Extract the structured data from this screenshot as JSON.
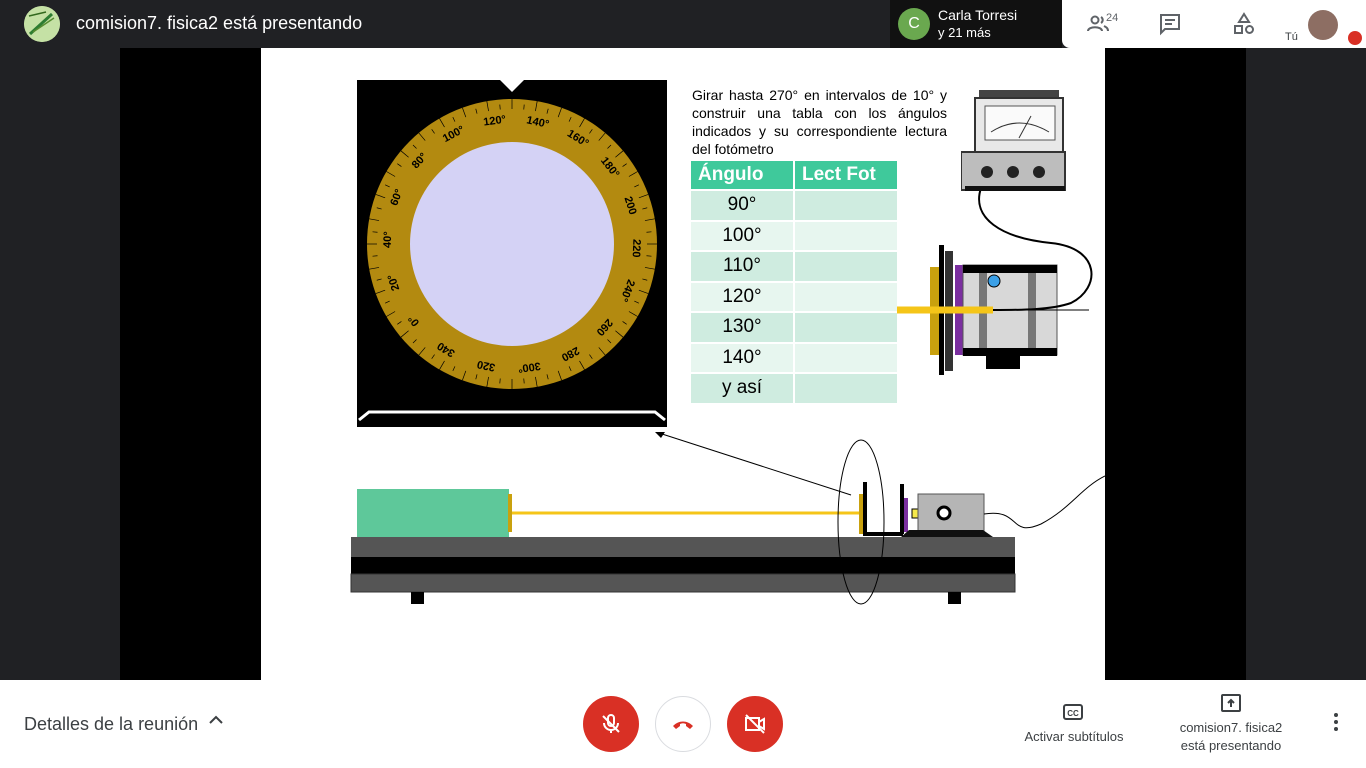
{
  "header": {
    "presenting_title": "comision7. fisica2 está presentando",
    "participant_initial": "C",
    "participant_name": "Carla Torresi",
    "participant_more": "y 21 más",
    "people_count": "24",
    "self_label": "Tú"
  },
  "slide": {
    "instructions": "Girar hasta 270° en intervalos de 10° y construir una tabla con los ángulos indicados y su correspondiente lectura del fotómetro",
    "table": {
      "headers": [
        "Ángulo",
        "Lect Fot"
      ],
      "rows": [
        [
          "90°",
          ""
        ],
        [
          "100°",
          ""
        ],
        [
          "110°",
          ""
        ],
        [
          "120°",
          ""
        ],
        [
          "130°",
          ""
        ],
        [
          "140°",
          ""
        ],
        [
          "y así",
          ""
        ]
      ]
    },
    "dial_labels": [
      "0°",
      "20°",
      "40°",
      "60°",
      "80°",
      "100°",
      "120°",
      "140°",
      "160°",
      "180°",
      "200",
      "220",
      "240°",
      "260",
      "280",
      "300°",
      "320",
      "340"
    ],
    "colors": {
      "dial_ring": "#b38a10",
      "dial_center": "#d4d2f5",
      "laser_source": "#5ec89a",
      "beam": "#f5c518",
      "polarizer": "#7b2fa0"
    }
  },
  "footer": {
    "meeting_details": "Detalles de la reunión",
    "captions_label": "Activar subtítulos",
    "present_label_line1": "comision7. fisica2",
    "present_label_line2": "está presentando"
  },
  "icons": [
    "pen-logo-icon",
    "people-icon",
    "chat-icon",
    "activities-icon",
    "mic-off-icon",
    "hangup-icon",
    "camera-off-icon",
    "captions-icon",
    "present-icon",
    "more-vert-icon",
    "chevron-up-icon"
  ]
}
